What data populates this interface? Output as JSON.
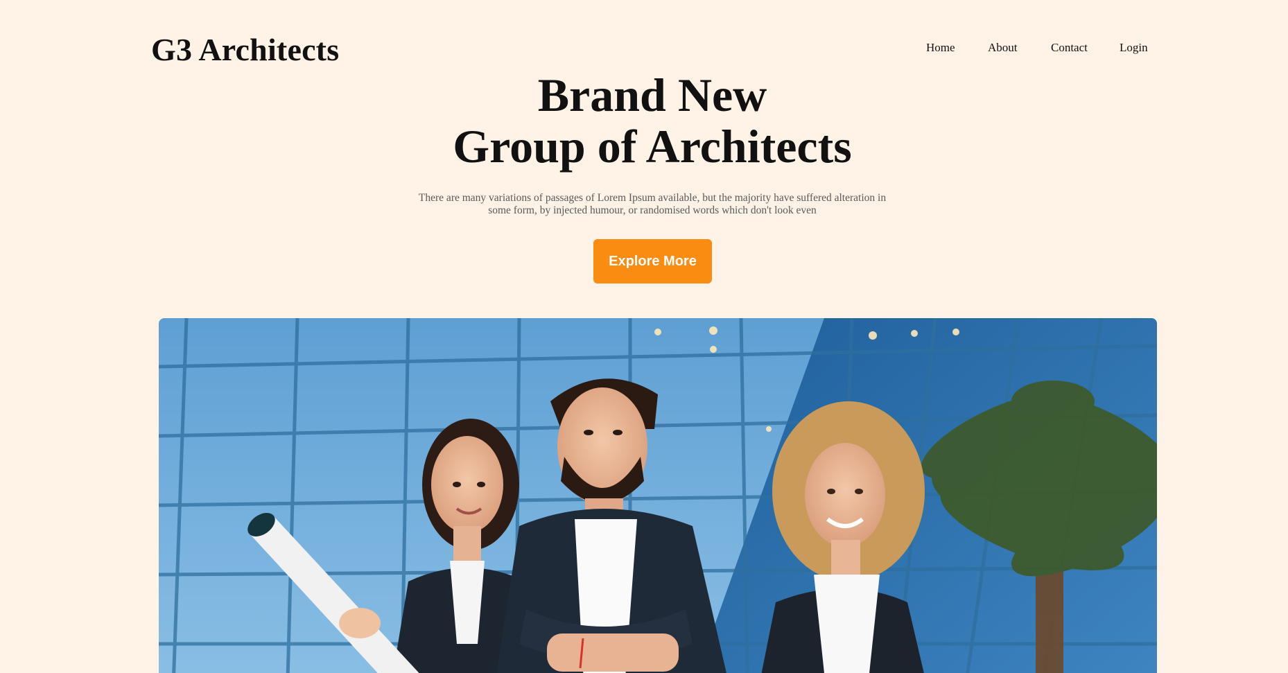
{
  "header": {
    "logo": "G3 Architects",
    "nav": [
      "Home",
      "About",
      "Contact",
      "Login"
    ]
  },
  "hero": {
    "title_line1": "Brand New",
    "title_line2": "Group of Architects",
    "subtitle": "There are many variations of passages of Lorem Ipsum available, but the majority have suffered alteration in some form, by injected humour, or randomised words which don't look even",
    "cta_label": "Explore More"
  },
  "colors": {
    "background": "#fff2e6",
    "accent": "#fb8c12",
    "text": "#111111",
    "subtext": "#5a5a5a"
  }
}
